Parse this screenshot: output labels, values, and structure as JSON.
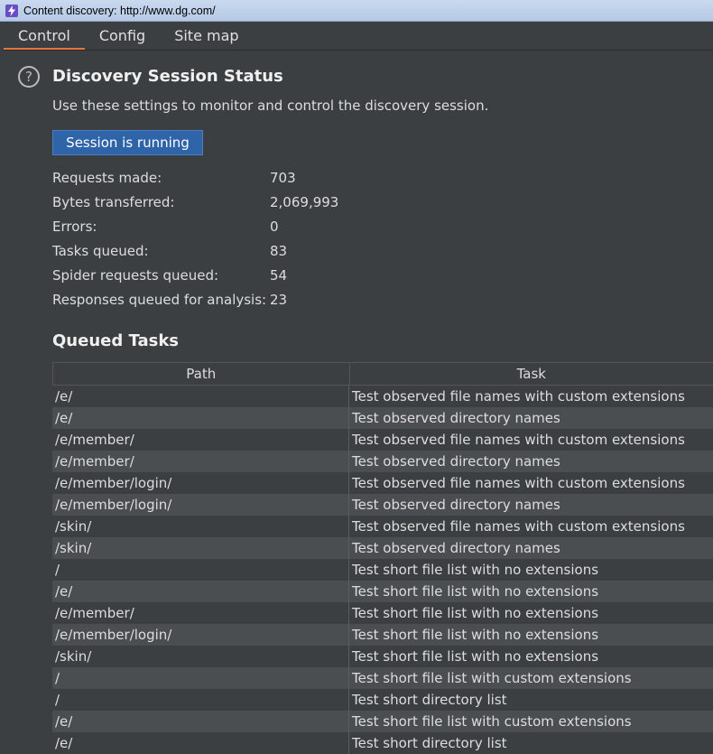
{
  "window": {
    "title": "Content discovery: http://www.dg.com/"
  },
  "tabs": [
    {
      "label": "Control",
      "active": true
    },
    {
      "label": "Config",
      "active": false
    },
    {
      "label": "Site map",
      "active": false
    }
  ],
  "status": {
    "heading": "Discovery Session Status",
    "description": "Use these settings to monitor and control the discovery session.",
    "session_button": "Session is running",
    "stats": [
      {
        "label": "Requests made:",
        "value": "703"
      },
      {
        "label": "Bytes transferred:",
        "value": "2,069,993"
      },
      {
        "label": "Errors:",
        "value": "0"
      },
      {
        "label": "Tasks queued:",
        "value": "83"
      },
      {
        "label": "Spider requests queued:",
        "value": "54"
      },
      {
        "label": "Responses queued for analysis:",
        "value": "23"
      }
    ]
  },
  "queued": {
    "heading": "Queued Tasks",
    "columns": [
      "Path",
      "Task"
    ],
    "rows": [
      [
        "/e/",
        "Test observed file names with custom extensions"
      ],
      [
        "/e/",
        "Test observed directory names"
      ],
      [
        "/e/member/",
        "Test observed file names with custom extensions"
      ],
      [
        "/e/member/",
        "Test observed directory names"
      ],
      [
        "/e/member/login/",
        "Test observed file names with custom extensions"
      ],
      [
        "/e/member/login/",
        "Test observed directory names"
      ],
      [
        "/skin/",
        "Test observed file names with custom extensions"
      ],
      [
        "/skin/",
        "Test observed directory names"
      ],
      [
        "/",
        "Test short file list with no extensions"
      ],
      [
        "/e/",
        "Test short file list with no extensions"
      ],
      [
        "/e/member/",
        "Test short file list with no extensions"
      ],
      [
        "/e/member/login/",
        "Test short file list with no extensions"
      ],
      [
        "/skin/",
        "Test short file list with no extensions"
      ],
      [
        "/",
        "Test short file list with custom extensions"
      ],
      [
        "/",
        "Test short directory list"
      ],
      [
        "/e/",
        "Test short file list with custom extensions"
      ],
      [
        "/e/",
        "Test short directory list"
      ]
    ]
  },
  "colors": {
    "accent_tab_underline": "#e8743b",
    "button_blue": "#2f65a8",
    "panel_bg": "#3c3f41",
    "row_alt_bg": "#4b4e51"
  },
  "icons": {
    "app": "lightning-icon",
    "help": "question-circle-icon"
  }
}
